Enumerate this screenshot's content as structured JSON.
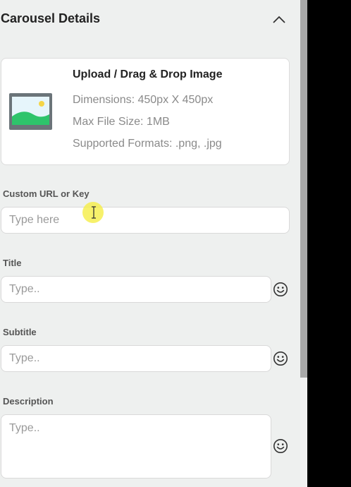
{
  "section": {
    "title": "Carousel Details",
    "collapse_icon": "chevron-up-icon"
  },
  "upload": {
    "title": "Upload / Drag & Drop Image",
    "dimensions": "Dimensions: 450px X 450px",
    "max_size": "Max File Size: 1MB",
    "formats": "Supported Formats: .png, .jpg",
    "icon": "image-placeholder-icon"
  },
  "fields": {
    "custom_url": {
      "label": "Custom URL or Key",
      "placeholder": "Type here",
      "value": ""
    },
    "title": {
      "label": "Title",
      "placeholder": "Type..",
      "value": "",
      "emoji_icon": "smiley-icon"
    },
    "subtitle": {
      "label": "Subtitle",
      "placeholder": "Type..",
      "value": "",
      "emoji_icon": "smiley-icon"
    },
    "description": {
      "label": "Description",
      "placeholder": "Type..",
      "value": "",
      "emoji_icon": "smiley-icon"
    }
  },
  "colors": {
    "panel_bg": "#eef0ef",
    "card_bg": "#ffffff",
    "border": "#d9d9d9",
    "heading": "#222222",
    "muted_text": "#8a8a8a",
    "image_green": "#2ec46b",
    "image_sky": "#e6f5fb",
    "image_frame": "#6b7479",
    "cursor_highlight": "#f5ee46"
  }
}
